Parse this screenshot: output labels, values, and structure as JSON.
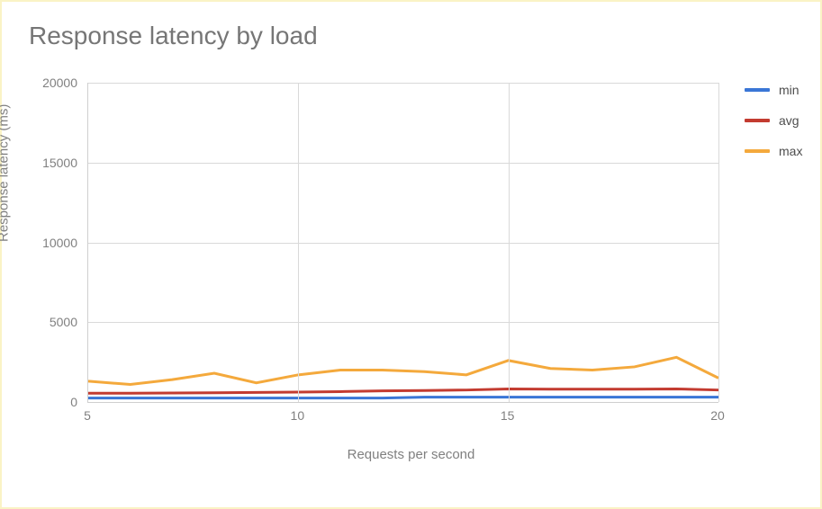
{
  "chart_data": {
    "type": "line",
    "title": "Response latency by load",
    "xlabel": "Requests per second",
    "ylabel": "Response latency (ms)",
    "xlim": [
      5,
      20
    ],
    "ylim": [
      0,
      20000
    ],
    "x_ticks": [
      5,
      10,
      15,
      20
    ],
    "y_ticks": [
      0,
      5000,
      10000,
      15000,
      20000
    ],
    "x": [
      5,
      6,
      7,
      8,
      9,
      10,
      11,
      12,
      13,
      14,
      15,
      16,
      17,
      18,
      19,
      20
    ],
    "series": [
      {
        "name": "min",
        "color": "#3a76d6",
        "values": [
          250,
          250,
          250,
          250,
          250,
          250,
          250,
          250,
          300,
          300,
          300,
          300,
          300,
          300,
          300,
          300
        ]
      },
      {
        "name": "avg",
        "color": "#c33b30",
        "values": [
          550,
          550,
          560,
          580,
          600,
          620,
          650,
          700,
          720,
          750,
          820,
          800,
          800,
          800,
          820,
          750
        ]
      },
      {
        "name": "max",
        "color": "#f4a93c",
        "values": [
          1300,
          1100,
          1400,
          1800,
          1200,
          1700,
          2000,
          2000,
          1900,
          1700,
          2600,
          2100,
          2000,
          2200,
          2800,
          1500
        ]
      }
    ],
    "legend_position": "right"
  }
}
